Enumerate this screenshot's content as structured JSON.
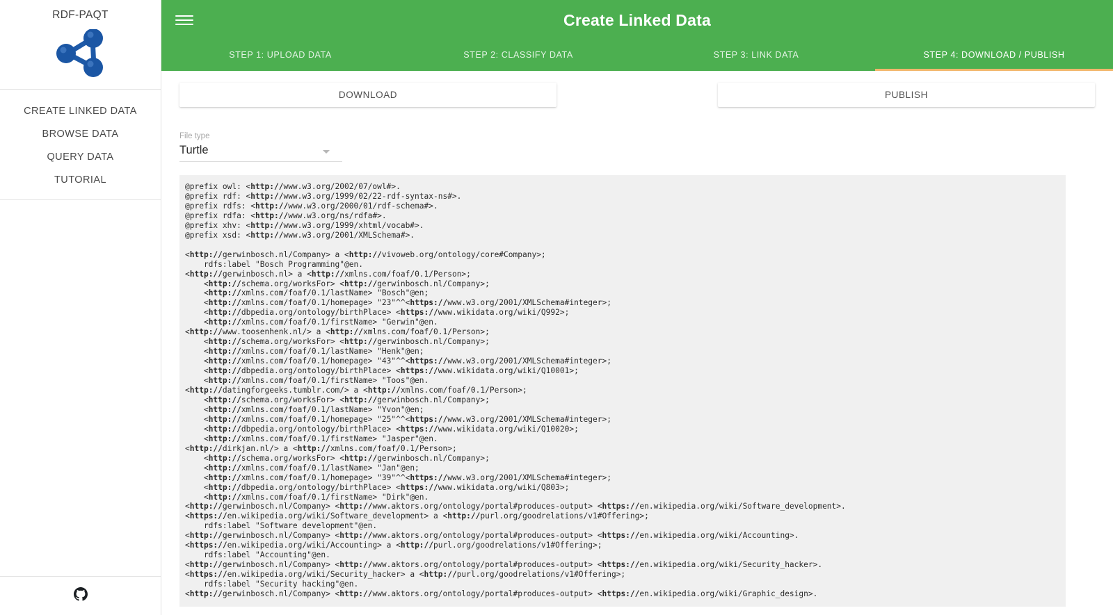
{
  "sidebar": {
    "brand_title": "RDF-PAQT",
    "logo_icon": "molecule-graph-icon",
    "items": [
      {
        "label": "CREATE LINKED DATA"
      },
      {
        "label": "BROWSE DATA"
      },
      {
        "label": "QUERY DATA"
      },
      {
        "label": "TUTORIAL"
      }
    ],
    "footer_icon": "github-icon"
  },
  "header": {
    "menu_icon": "hamburger-menu-icon",
    "title": "Create Linked Data",
    "background_color": "#4caf50"
  },
  "tabs": {
    "active_index": 3,
    "active_underline_color": "#f2b76c",
    "items": [
      {
        "label": "STEP 1: UPLOAD DATA"
      },
      {
        "label": "STEP 2: CLASSIFY DATA"
      },
      {
        "label": "STEP 3: LINK DATA"
      },
      {
        "label": "STEP 4: DOWNLOAD / PUBLISH"
      }
    ]
  },
  "actions": {
    "download_label": "DOWNLOAD",
    "publish_label": "PUBLISH"
  },
  "file_type": {
    "label": "File type",
    "value": "Turtle",
    "caret_icon": "chevron-down-icon"
  },
  "code_output": {
    "language": "turtle",
    "background_color": "#f0f0f0",
    "text": "@prefix owl: <http://www.w3.org/2002/07/owl#>.\n@prefix rdf: <http://www.w3.org/1999/02/22-rdf-syntax-ns#>.\n@prefix rdfs: <http://www.w3.org/2000/01/rdf-schema#>.\n@prefix rdfa: <http://www.w3.org/ns/rdfa#>.\n@prefix xhv: <http://www.w3.org/1999/xhtml/vocab#>.\n@prefix xsd: <http://www.w3.org/2001/XMLSchema#>.\n\n<http://gerwinbosch.nl/Company> a <http://vivoweb.org/ontology/core#Company>;\n    rdfs:label \"Bosch Programming\"@en.\n<http://gerwinbosch.nl> a <http://xmlns.com/foaf/0.1/Person>;\n    <http://schema.org/worksFor> <http://gerwinbosch.nl/Company>;\n    <http://xmlns.com/foaf/0.1/lastName> \"Bosch\"@en;\n    <http://xmlns.com/foaf/0.1/homepage> \"23\"^^<https://www.w3.org/2001/XMLSchema#integer>;\n    <http://dbpedia.org/ontology/birthPlace> <https://www.wikidata.org/wiki/Q992>;\n    <http://xmlns.com/foaf/0.1/firstName> \"Gerwin\"@en.\n<http://www.toosenhenk.nl/> a <http://xmlns.com/foaf/0.1/Person>;\n    <http://schema.org/worksFor> <http://gerwinbosch.nl/Company>;\n    <http://xmlns.com/foaf/0.1/lastName> \"Henk\"@en;\n    <http://xmlns.com/foaf/0.1/homepage> \"43\"^^<https://www.w3.org/2001/XMLSchema#integer>;\n    <http://dbpedia.org/ontology/birthPlace> <https://www.wikidata.org/wiki/Q10001>;\n    <http://xmlns.com/foaf/0.1/firstName> \"Toos\"@en.\n<http://datingforgeeks.tumblr.com/> a <http://xmlns.com/foaf/0.1/Person>;\n    <http://schema.org/worksFor> <http://gerwinbosch.nl/Company>;\n    <http://xmlns.com/foaf/0.1/lastName> \"Yvon\"@en;\n    <http://xmlns.com/foaf/0.1/homepage> \"25\"^^<https://www.w3.org/2001/XMLSchema#integer>;\n    <http://dbpedia.org/ontology/birthPlace> <https://www.wikidata.org/wiki/Q10020>;\n    <http://xmlns.com/foaf/0.1/firstName> \"Jasper\"@en.\n<http://dirkjan.nl/> a <http://xmlns.com/foaf/0.1/Person>;\n    <http://schema.org/worksFor> <http://gerwinbosch.nl/Company>;\n    <http://xmlns.com/foaf/0.1/lastName> \"Jan\"@en;\n    <http://xmlns.com/foaf/0.1/homepage> \"39\"^^<https://www.w3.org/2001/XMLSchema#integer>;\n    <http://dbpedia.org/ontology/birthPlace> <https://www.wikidata.org/wiki/Q803>;\n    <http://xmlns.com/foaf/0.1/firstName> \"Dirk\"@en.\n<http://gerwinbosch.nl/Company> <http://www.aktors.org/ontology/portal#produces-output> <https://en.wikipedia.org/wiki/Software_development>.\n<https://en.wikipedia.org/wiki/Software_development> a <http://purl.org/goodrelations/v1#Offering>;\n    rdfs:label \"Software development\"@en.\n<http://gerwinbosch.nl/Company> <http://www.aktors.org/ontology/portal#produces-output> <https://en.wikipedia.org/wiki/Accounting>.\n<https://en.wikipedia.org/wiki/Accounting> a <http://purl.org/goodrelations/v1#Offering>;\n    rdfs:label \"Accounting\"@en.\n<http://gerwinbosch.nl/Company> <http://www.aktors.org/ontology/portal#produces-output> <https://en.wikipedia.org/wiki/Security_hacker>.\n<https://en.wikipedia.org/wiki/Security_hacker> a <http://purl.org/goodrelations/v1#Offering>;\n    rdfs:label \"Security hacking\"@en.\n<http://gerwinbosch.nl/Company> <http://www.aktors.org/ontology/portal#produces-output> <https://en.wikipedia.org/wiki/Graphic_design>."
  }
}
